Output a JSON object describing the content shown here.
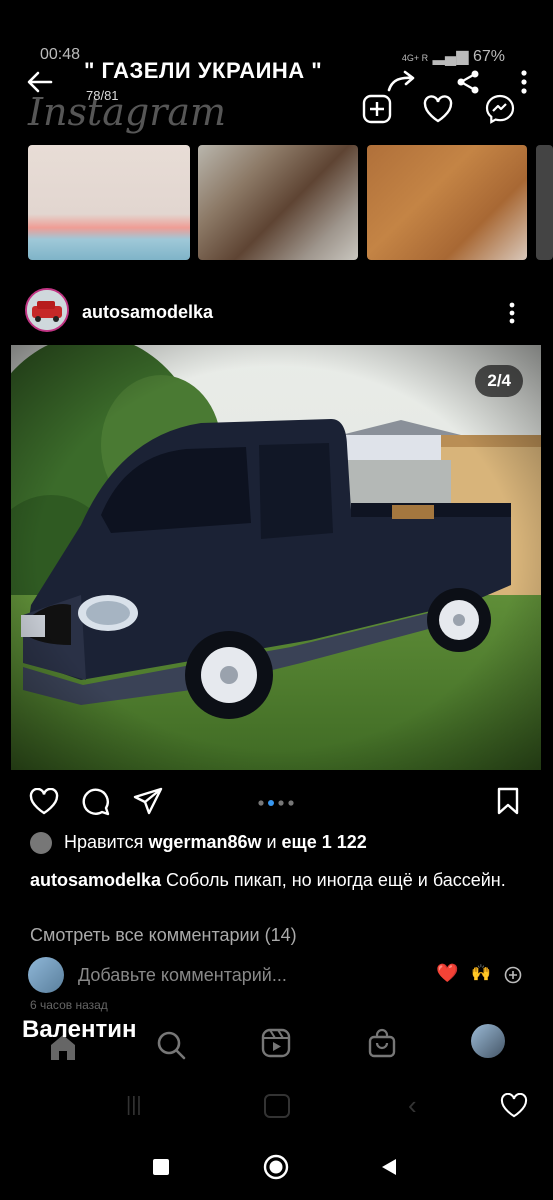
{
  "status": {
    "time": "00:48",
    "network": "4G+ R",
    "battery": "67%"
  },
  "header": {
    "title": "\" ГАЗЕЛИ УКРАИНА \"",
    "counter": "78/81",
    "brand": "Instagram"
  },
  "post": {
    "username": "autosamodelka",
    "pager": "2/4",
    "likes": {
      "prefix": "Нравится ",
      "user": "wgerman86w",
      "middle": " и ",
      "count": "еще 1 122"
    },
    "caption": {
      "user": "autosamodelka",
      "text": " Соболь пикап, но иногда ещё и бассейн."
    },
    "view_comments": "Смотреть все комментарии (14)",
    "comment_placeholder": "Добавьте комментарий...",
    "quick_emojis": [
      "❤️",
      "🙌"
    ],
    "time_ago": "6 часов назад"
  },
  "overlay_subtitle": "Валентин",
  "colors": {
    "background": "#000000",
    "story_ring": "#c13584",
    "accent_dot": "#3897f0"
  }
}
